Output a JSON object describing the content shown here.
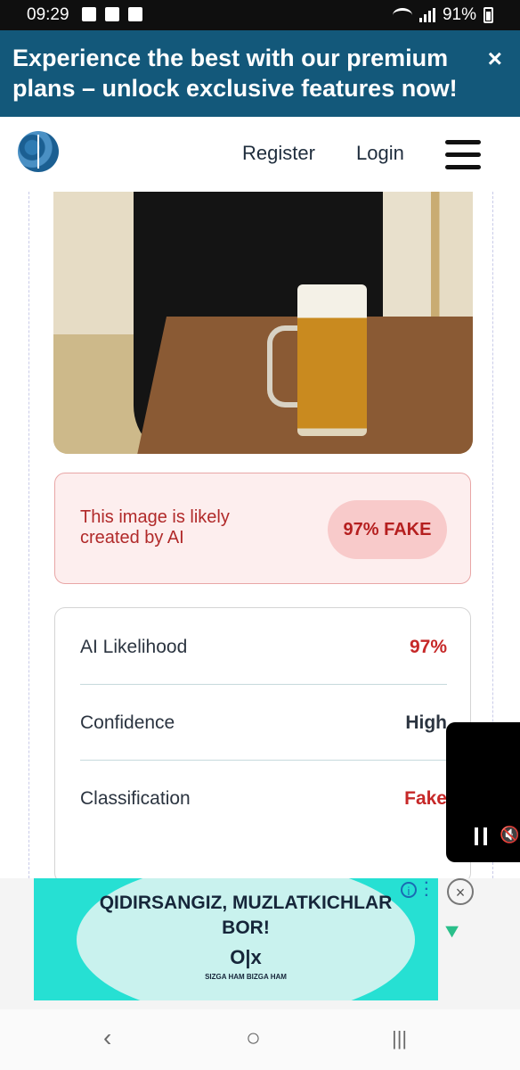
{
  "status_bar": {
    "time": "09:29",
    "battery": "91%"
  },
  "promo": {
    "text": "Experience the best with our premium plans – unlock exclusive features now!",
    "close": "×"
  },
  "header": {
    "register": "Register",
    "login": "Login"
  },
  "verdict": {
    "message": "This image is likely created by AI",
    "badge": "97% FAKE"
  },
  "details": [
    {
      "label": "AI Likelihood",
      "value": "97%",
      "color": "#c62828"
    },
    {
      "label": "Confidence",
      "value": "High",
      "color": "#2b3440"
    },
    {
      "label": "Classification",
      "value": "Fake",
      "color": "#c62828"
    }
  ],
  "ad": {
    "headline": "QIDIRSANGIZ, MUZLATKICHLAR BOR!",
    "brand": "O|x",
    "tagline": "SIZGA HAM BIZGA HAM",
    "info": "i",
    "close": "×"
  },
  "navbar": {
    "back": "‹",
    "home": "○",
    "recents": "|||"
  }
}
